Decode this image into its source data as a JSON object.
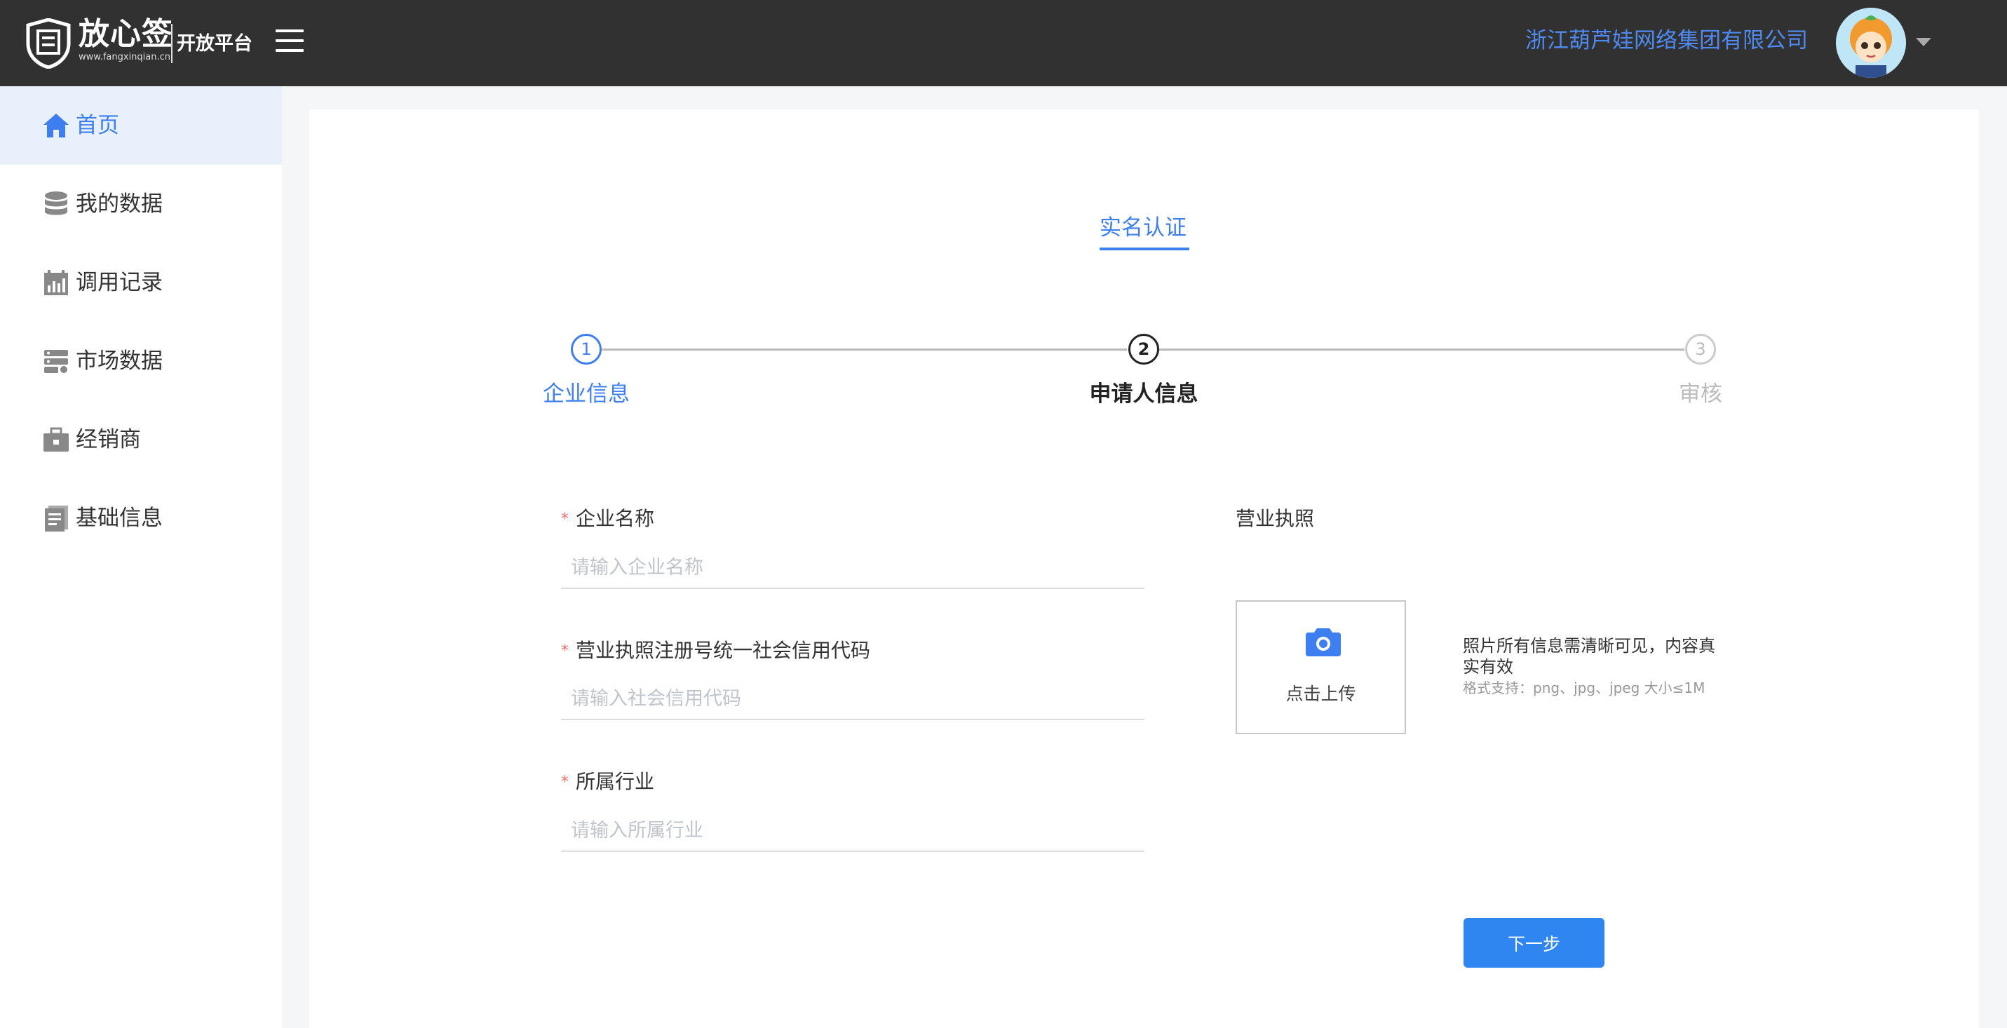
{
  "header": {
    "brand_name": "放心签",
    "brand_url": "www.fangxinqian.cn",
    "brand_sub": "开放平台",
    "company_name": "浙江葫芦娃网络集团有限公司"
  },
  "sidebar": {
    "items": [
      {
        "label": "首页",
        "icon": "home-icon",
        "active": true
      },
      {
        "label": "我的数据",
        "icon": "database-icon"
      },
      {
        "label": "调用记录",
        "icon": "calendar-chart-icon"
      },
      {
        "label": "市场数据",
        "icon": "server-icon"
      },
      {
        "label": "经销商",
        "icon": "briefcase-icon"
      },
      {
        "label": "基础信息",
        "icon": "document-icon"
      }
    ]
  },
  "main": {
    "title": "实名认证",
    "steps": [
      {
        "number": "1",
        "label": "企业信息",
        "state": "done"
      },
      {
        "number": "2",
        "label": "申请人信息",
        "state": "current"
      },
      {
        "number": "3",
        "label": "审核",
        "state": "pending"
      }
    ],
    "form": {
      "company_name": {
        "label": "企业名称",
        "placeholder": "请输入企业名称",
        "value": ""
      },
      "credit_code": {
        "label": "营业执照注册号统一社会信用代码",
        "placeholder": "请输入社会信用代码",
        "value": ""
      },
      "industry": {
        "label": "所属行业",
        "placeholder": "请输入所属行业",
        "value": ""
      }
    },
    "license": {
      "label": "营业执照",
      "upload_text": "点击上传",
      "hint_main": "照片所有信息需清晰可见，内容真实有效",
      "hint_sub": "格式支持：png、jpg、jpeg 大小≤1M"
    },
    "next_button": "下一步"
  },
  "colors": {
    "accent": "#3d7ef0",
    "header_bg": "#313131",
    "button_bg": "#2f86f0",
    "required": "#f56c6c"
  }
}
